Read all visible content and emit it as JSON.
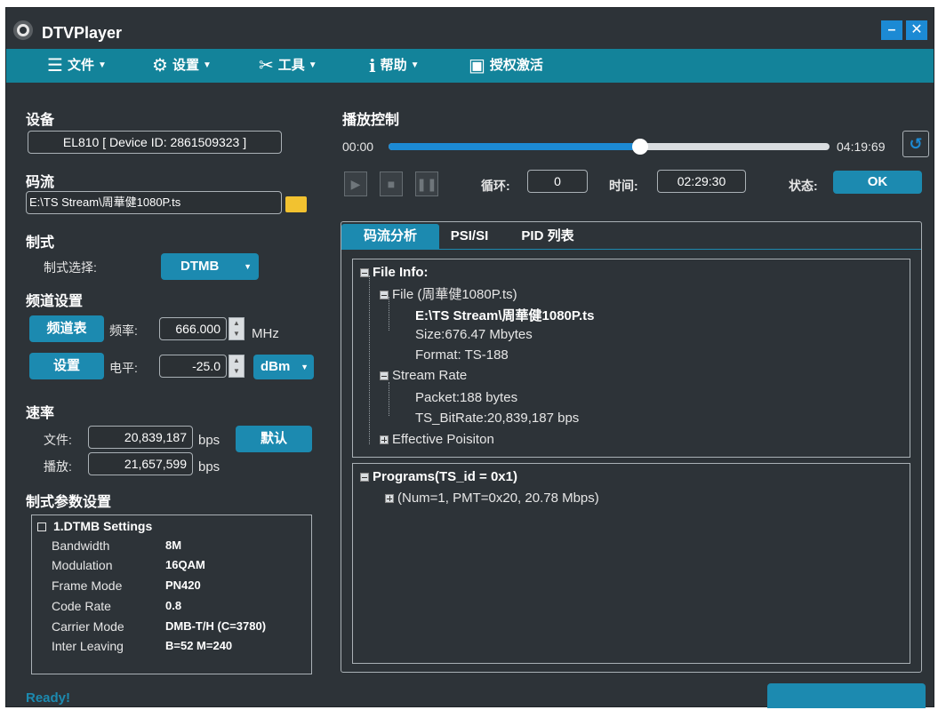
{
  "app": {
    "title": "DTVPlayer"
  },
  "menu": [
    {
      "label": "文件",
      "icon": "list-icon"
    },
    {
      "label": "设置",
      "icon": "gear-icon"
    },
    {
      "label": "工具",
      "icon": "tools-icon"
    },
    {
      "label": "帮助",
      "icon": "info-icon"
    },
    {
      "label": "授权激活",
      "icon": "key-icon"
    }
  ],
  "device": {
    "title": "设备",
    "value": "EL810 [ Device ID: 2861509323 ]"
  },
  "stream": {
    "title": "码流",
    "path": "E:\\TS Stream\\周華健1080P.ts"
  },
  "mode": {
    "title": "制式",
    "label": "制式选择:",
    "value": "DTMB"
  },
  "channel": {
    "title": "频道设置",
    "table_btn": "频道表",
    "freq_label": "频率:",
    "freq_value": "666.000",
    "freq_unit": "MHz",
    "set_btn": "设置",
    "level_label": "电平:",
    "level_value": "-25.0",
    "level_unit": "dBm"
  },
  "rate": {
    "title": "速率",
    "file_label": "文件:",
    "file_value": "20,839,187",
    "play_label": "播放:",
    "play_value": "21,657,599",
    "unit": "bps",
    "default_btn": "默认"
  },
  "params": {
    "title": "制式参数设置",
    "group": "1.DTMB Settings",
    "rows": [
      {
        "key": "Bandwidth",
        "value": "8M"
      },
      {
        "key": "Modulation",
        "value": "16QAM"
      },
      {
        "key": "Frame Mode",
        "value": "PN420"
      },
      {
        "key": "Code Rate",
        "value": "0.8"
      },
      {
        "key": "Carrier Mode",
        "value": "DMB-T/H (C=3780)"
      },
      {
        "key": "Inter Leaving",
        "value": "B=52 M=240"
      }
    ]
  },
  "playback": {
    "title": "播放控制",
    "start_time": "00:00",
    "end_time": "04:19:69",
    "progress": 0.57,
    "loop_label": "循环:",
    "loop_value": "0",
    "time_label": "时间:",
    "time_value": "02:29:30",
    "state_label": "状态:",
    "state_value": "OK"
  },
  "tabs": [
    {
      "label": "码流分析",
      "active": true
    },
    {
      "label": "PSI/SI",
      "active": false
    },
    {
      "label": "PID 列表",
      "active": false
    }
  ],
  "file_tree": {
    "root": "File Info:",
    "file_node": "File (周華健1080P.ts)",
    "path": "E:\\TS Stream\\周華健1080P.ts",
    "size": "Size:676.47 Mbytes",
    "format": "Format: TS-188",
    "stream_rate": "Stream Rate",
    "packet": "Packet:188 bytes",
    "bitrate": "TS_BitRate:20,839,187 bps",
    "position": "Effective Poisiton"
  },
  "programs_tree": {
    "root": "Programs(TS_id = 0x1)",
    "item": "(Num=1, PMT=0x20, 20.78 Mbps)"
  },
  "status": {
    "text": "Ready!"
  },
  "colors": {
    "menu": "#13839a",
    "accent": "#1c8ab0",
    "window": "#2d3338"
  }
}
